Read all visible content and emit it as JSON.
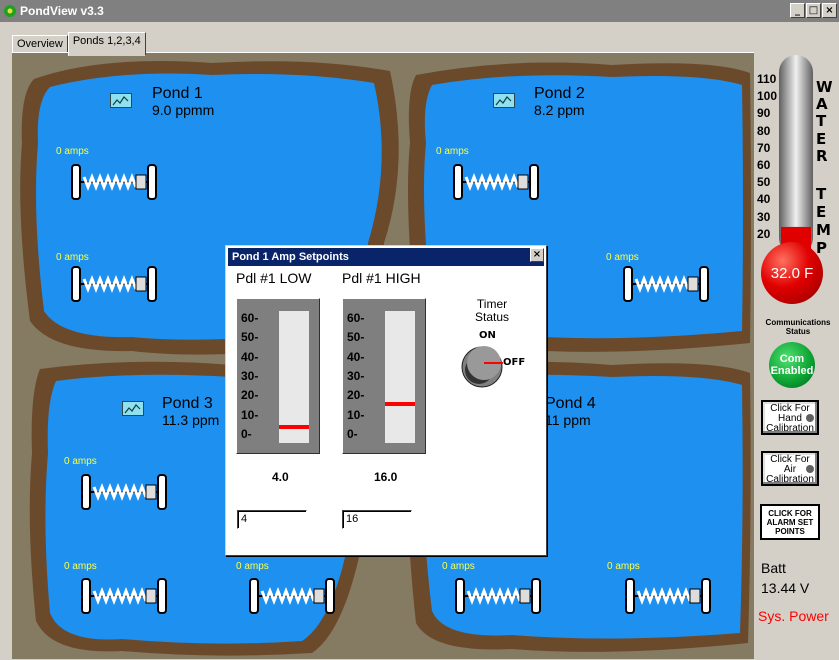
{
  "window": {
    "title": "PondView v3.3",
    "minimize": "_",
    "maximize": "□",
    "close": "×"
  },
  "tabs": [
    {
      "label": "Overview"
    },
    {
      "label": "Ponds 1,2,3,4"
    }
  ],
  "ponds": [
    {
      "name": "Pond 1",
      "ppm": "9.0 ppmm",
      "amps": [
        "0 amps",
        "0 amps"
      ]
    },
    {
      "name": "Pond 2",
      "ppm": "8.2 ppm",
      "amps": [
        "0 amps",
        "0 amps"
      ]
    },
    {
      "name": "Pond 3",
      "ppm": "11.3 ppm",
      "amps": [
        "0 amps",
        "0 amps"
      ]
    },
    {
      "name": "Pond 4",
      "ppm": "11 ppm",
      "amps": [
        "0 amps",
        "0 amps"
      ]
    }
  ],
  "thermometer": {
    "scale": [
      "110",
      "100",
      "90",
      "80",
      "70",
      "60",
      "50",
      "40",
      "30",
      "20"
    ],
    "label_letters": [
      "W",
      "A",
      "T",
      "E",
      "R",
      "T",
      "E",
      "M",
      "P"
    ],
    "reading": "32.0 F",
    "level_f": 32.0,
    "range_f": [
      20,
      110
    ]
  },
  "comm": {
    "status_label": "Communications Status",
    "button": "Com Enabled"
  },
  "buttons": {
    "hand_cal": "Click For Hand Calibration",
    "air_cal": "Click For Air Calibration",
    "alarm": "CLICK FOR ALARM SET POINTS"
  },
  "battery": {
    "label": "Batt",
    "value": "13.44 V"
  },
  "sys_power": "Sys. Power",
  "dialog": {
    "title": "Pond 1 Amp Setpoints",
    "close": "×",
    "low": {
      "label": "Pdl #1 LOW",
      "value": "4.0",
      "input": "4",
      "setpoint": 4
    },
    "high": {
      "label": "Pdl #1 HIGH",
      "value": "16.0",
      "input": "16",
      "setpoint": 16
    },
    "gauge_ticks": [
      "60-",
      "50-",
      "40-",
      "30-",
      "20-",
      "10-",
      "0-"
    ],
    "gauge_range": [
      0,
      60
    ],
    "timer": {
      "label": "Timer Status",
      "on": "ON",
      "off": "OFF",
      "state": "OFF"
    }
  }
}
